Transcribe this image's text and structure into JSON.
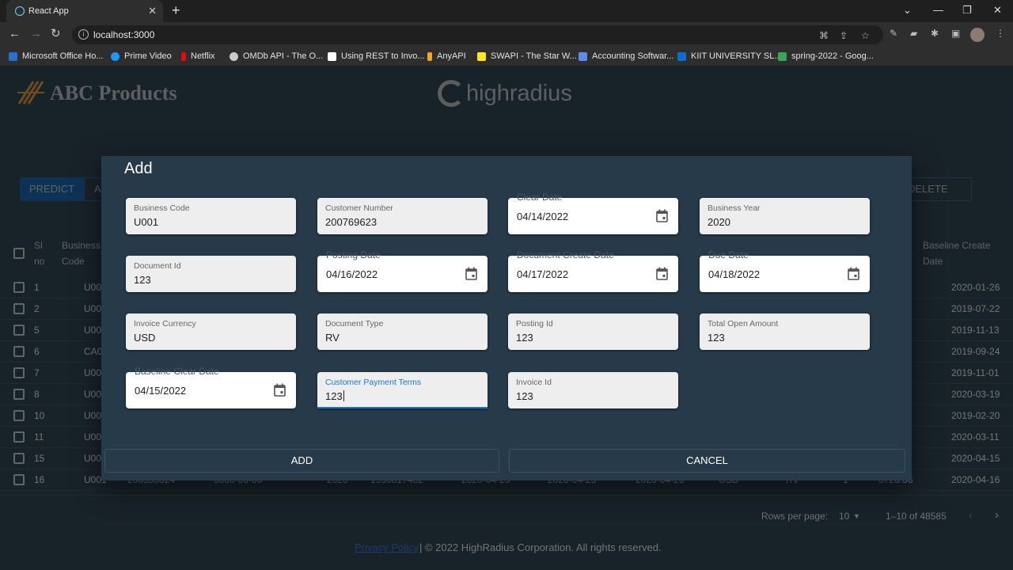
{
  "browser": {
    "tab_title": "React App",
    "url": "localhost:3000",
    "bookmarks": [
      {
        "label": "Microsoft Office Ho...",
        "color": "#2b6fd6"
      },
      {
        "label": "Prime Video",
        "color": "#1a98ff"
      },
      {
        "label": "Netflix",
        "color": "#e50914"
      },
      {
        "label": "OMDb API - The O...",
        "color": "#cccccc"
      },
      {
        "label": "Using REST to Invo...",
        "color": "#ffffff"
      },
      {
        "label": "AnyAPI",
        "color": "#f5a623"
      },
      {
        "label": "SWAPI - The Star W...",
        "color": "#ffe81f"
      },
      {
        "label": "Accounting Softwar...",
        "color": "#5b8def"
      },
      {
        "label": "KIIT UNIVERSITY SL...",
        "color": "#0a6ed1"
      },
      {
        "label": "spring-2022 - Goog...",
        "color": "#34a853"
      }
    ]
  },
  "header": {
    "company_logo_text": "ABC Products",
    "brand_logo_text": "highradius"
  },
  "toolbar": {
    "predict_label": "PREDICT",
    "advanced_partial": "AI",
    "delete_partial": "DELETE"
  },
  "grid": {
    "headers": {
      "sl_no": "Sl no",
      "business_code": "Business Code",
      "baseline_create_date": "Baseline Create Date"
    },
    "rows": [
      {
        "sl": "1",
        "code": "U00",
        "baseline": "2020-01-26"
      },
      {
        "sl": "2",
        "code": "U00",
        "baseline": "2019-07-22"
      },
      {
        "sl": "5",
        "code": "U00",
        "baseline": "2019-11-13"
      },
      {
        "sl": "6",
        "code": "CA0",
        "baseline": "2019-09-24"
      },
      {
        "sl": "7",
        "code": "U00",
        "baseline": "2019-11-01"
      },
      {
        "sl": "8",
        "code": "U00",
        "baseline": "2020-03-19"
      },
      {
        "sl": "10",
        "code": "U00",
        "baseline": "2019-02-20"
      },
      {
        "sl": "11",
        "code": "U00",
        "baseline": "2020-03-11"
      },
      {
        "sl": "15",
        "code": "U00",
        "baseline": "2020-04-15"
      }
    ],
    "last_row": [
      "16",
      "U001",
      "200353024",
      "0000-00-00",
      "2020",
      "1930817482",
      "2020-04-23",
      "2020-04-23",
      "2020-04-26",
      "USD",
      "RV",
      "1",
      "3726.06",
      "2020-04-16"
    ]
  },
  "pagination": {
    "rows_per_page_label": "Rows per page:",
    "rows_per_page": "10",
    "range": "1–10 of 48585"
  },
  "footer": {
    "privacy_link": "Privacy Policy",
    "copyright": "| © 2022 HighRadius Corporation. All rights reserved."
  },
  "dialog": {
    "title": "Add",
    "fields": {
      "business_code": {
        "label": "Business Code",
        "value": "U001"
      },
      "customer_number": {
        "label": "Customer Number",
        "value": "200769623"
      },
      "clear_date": {
        "label": "Clear Date",
        "value": "04/14/2022"
      },
      "business_year": {
        "label": "Business Year",
        "value": "2020"
      },
      "document_id": {
        "label": "Document Id",
        "value": "123"
      },
      "posting_date": {
        "label": "Posting Date",
        "value": "04/16/2022"
      },
      "document_create_date": {
        "label": "Document Create Date",
        "value": "04/17/2022"
      },
      "due_date": {
        "label": "Due Date",
        "value": "04/18/2022"
      },
      "invoice_currency": {
        "label": "Invoice Currency",
        "value": "USD"
      },
      "document_type": {
        "label": "Document Type",
        "value": "RV"
      },
      "posting_id": {
        "label": "Posting Id",
        "value": "123"
      },
      "total_open_amount": {
        "label": "Total Open Amount",
        "value": "123"
      },
      "baseline_clear_date": {
        "label": "Baseline Clear Date",
        "value": "04/15/2022"
      },
      "customer_payment_terms": {
        "label": "Customer Payment Terms",
        "value": "123"
      },
      "invoice_id": {
        "label": "Invoice Id",
        "value": "123"
      }
    },
    "add_label": "ADD",
    "cancel_label": "CANCEL"
  }
}
